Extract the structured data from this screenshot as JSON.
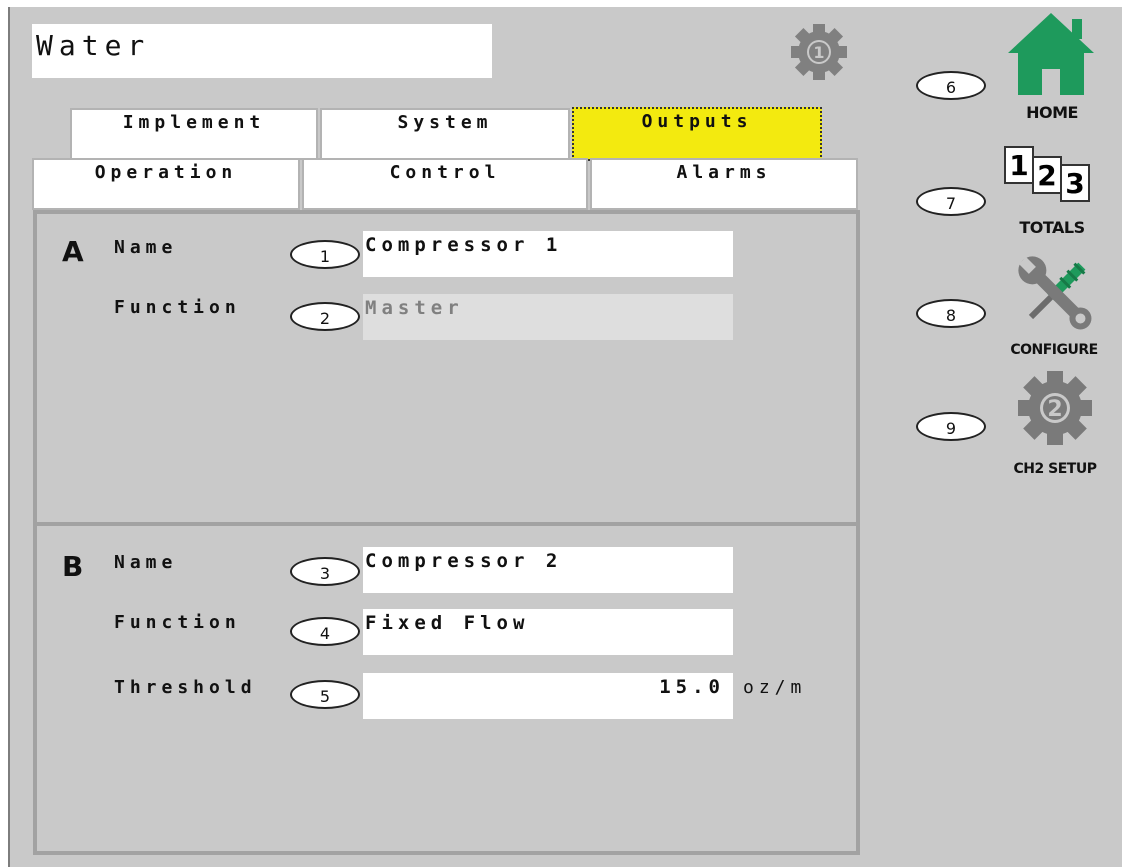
{
  "header": {
    "title": "Water",
    "channel_icon_number": "1"
  },
  "tabs_row1": [
    {
      "label": "Implement",
      "active": false
    },
    {
      "label": "System",
      "active": false
    },
    {
      "label": "Outputs",
      "active": true
    }
  ],
  "tabs_row2": [
    {
      "label": "Operation"
    },
    {
      "label": "Control"
    },
    {
      "label": "Alarms"
    }
  ],
  "section_a": {
    "letter": "A",
    "name_label": "Name",
    "name_marker": "1",
    "name_value": "Compressor 1",
    "function_label": "Function",
    "function_marker": "2",
    "function_value": "Master"
  },
  "section_b": {
    "letter": "B",
    "name_label": "Name",
    "name_marker": "3",
    "name_value": "Compressor 2",
    "function_label": "Function",
    "function_marker": "4",
    "function_value": "Fixed Flow",
    "threshold_label": "Threshold",
    "threshold_marker": "5",
    "threshold_value": "15.0",
    "threshold_unit": "oz/m"
  },
  "nav": [
    {
      "marker": "6",
      "label": "HOME",
      "icon": "home-icon"
    },
    {
      "marker": "7",
      "label": "TOTALS",
      "icon": "totals-123-icon",
      "digits": [
        "1",
        "2",
        "3"
      ]
    },
    {
      "marker": "8",
      "label": "CONFIGURE",
      "icon": "wrench-screwdriver-icon"
    },
    {
      "marker": "9",
      "label": "CH2 SETUP",
      "icon": "gear-icon",
      "icon_number": "2"
    }
  ],
  "colors": {
    "background": "#c9c9c9",
    "active_tab": "#f3ea0f",
    "home_green": "#1e9a5c",
    "icon_gray": "#7a7a7a"
  }
}
